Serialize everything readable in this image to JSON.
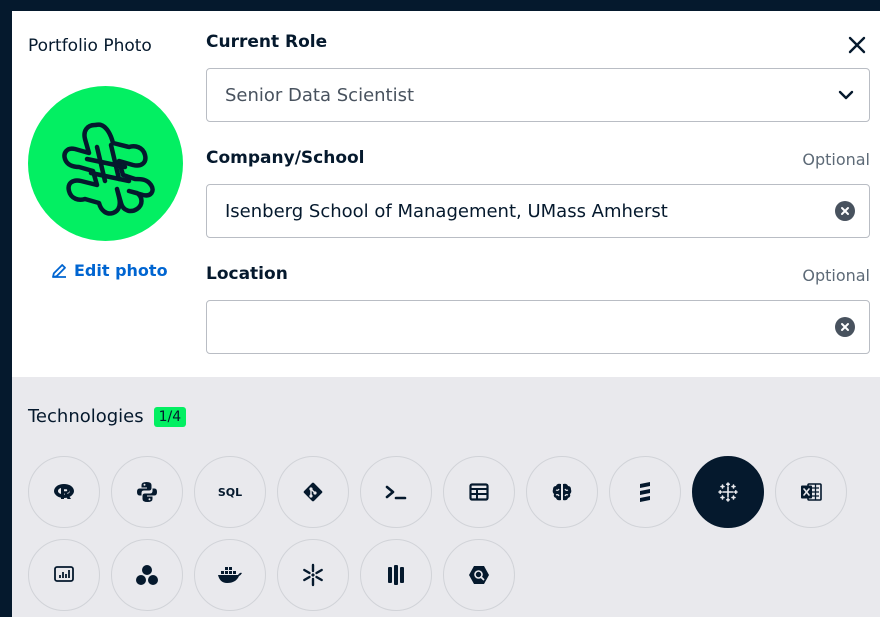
{
  "photo": {
    "label": "Portfolio Photo",
    "edit_label": "Edit photo"
  },
  "form": {
    "role": {
      "label": "Current Role",
      "value": "Senior Data Scientist"
    },
    "company": {
      "label": "Company/School",
      "optional": "Optional",
      "value": "Isenberg School of Management, UMass Amherst"
    },
    "location": {
      "label": "Location",
      "optional": "Optional",
      "value": ""
    }
  },
  "technologies": {
    "title": "Technologies",
    "badge": "1/4",
    "sql_label": "SQL",
    "items": [
      {
        "name": "R",
        "icon": "r-logo-icon",
        "selected": false
      },
      {
        "name": "Python",
        "icon": "python-logo-icon",
        "selected": false
      },
      {
        "name": "SQL",
        "icon": "sql-icon",
        "selected": false
      },
      {
        "name": "Git",
        "icon": "git-logo-icon",
        "selected": false
      },
      {
        "name": "Shell",
        "icon": "terminal-icon",
        "selected": false
      },
      {
        "name": "Spreadsheets",
        "icon": "spreadsheet-icon",
        "selected": false
      },
      {
        "name": "Theory",
        "icon": "brain-icon",
        "selected": false
      },
      {
        "name": "Scala",
        "icon": "scala-logo-icon",
        "selected": false
      },
      {
        "name": "Tableau",
        "icon": "tableau-logo-icon",
        "selected": true
      },
      {
        "name": "Excel",
        "icon": "excel-logo-icon",
        "selected": false
      },
      {
        "name": "Power BI",
        "icon": "power-bi-logo-icon",
        "selected": false
      },
      {
        "name": "Alteryx",
        "icon": "alteryx-logo-icon",
        "selected": false
      },
      {
        "name": "Docker",
        "icon": "docker-logo-icon",
        "selected": false
      },
      {
        "name": "Snowflake",
        "icon": "snowflake-logo-icon",
        "selected": false
      },
      {
        "name": "Databricks",
        "icon": "databricks-logo-icon",
        "selected": false
      },
      {
        "name": "BigQuery",
        "icon": "bigquery-logo-icon",
        "selected": false
      }
    ]
  },
  "colors": {
    "brand_green": "#03ef62",
    "navy": "#05192d",
    "link_blue": "#0065d1",
    "bg_gray": "#e9e9ed"
  }
}
